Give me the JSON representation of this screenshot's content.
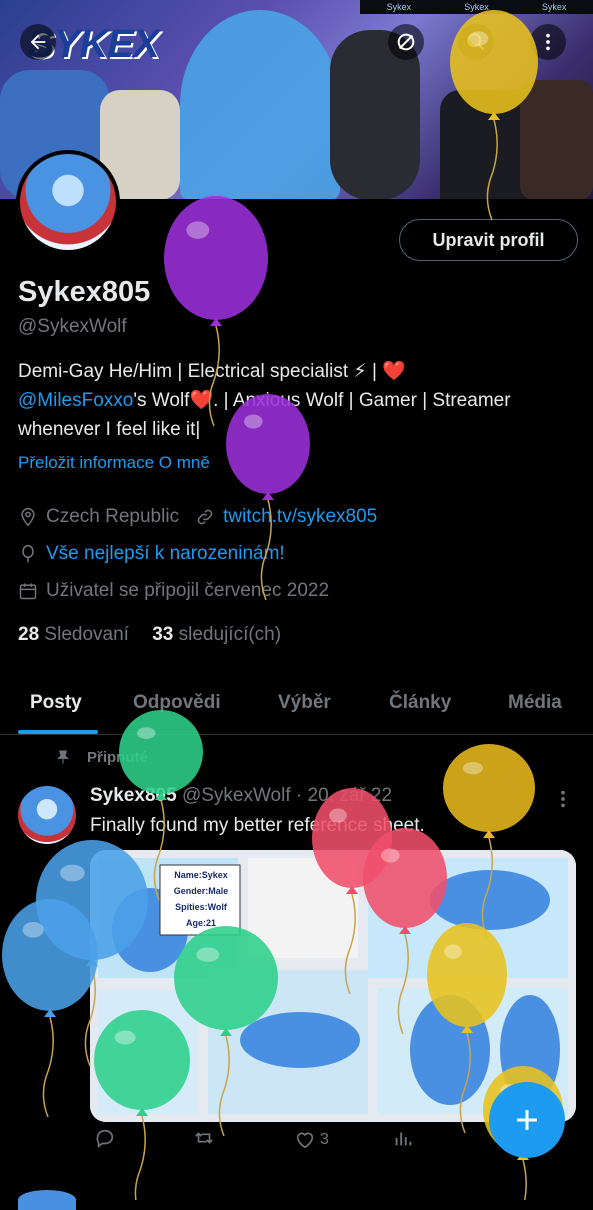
{
  "banner": {
    "logo_text": "SYKEX",
    "links": [
      "Sykex",
      "Sykex",
      "Sykex"
    ]
  },
  "top_bar": {
    "back_icon": "arrow-left-icon",
    "hide_icon": "eye-slash-icon",
    "search_icon": "search-icon",
    "more_icon": "more-vertical-icon"
  },
  "profile": {
    "edit_label": "Upravit profil",
    "name": "Sykex805",
    "handle": "@SykexWolf",
    "bio_line1": "Demi-Gay He/Him | Electrical specialist ⚡ | ❤️",
    "bio_mention": "@MilesFoxxo",
    "bio_line2_rest": "'s Wolf❤️.  | Anxious Wolf | Gamer | Streamer",
    "bio_line3": "whenever I feel like it|",
    "translate": "Přeložit informace O mně",
    "location": "Czech Republic",
    "website": "twitch.tv/sykex805",
    "birthday": "Vše nejlepší k narozeninám!",
    "joined": "Uživatel se připojil červenec 2022",
    "following_count": "28",
    "following_label": "Sledovaní",
    "followers_count": "33",
    "followers_label": "sledující(ch)"
  },
  "tabs": [
    "Posty",
    "Odpovědi",
    "Výběr",
    "Články",
    "Média"
  ],
  "pinned_post": {
    "pinned_label": "Připnuté",
    "author_name": "Sykex805",
    "author_handle": "@SykexWolf",
    "date": "· 20. zář 22",
    "text": "Finally found my better reference sheet.",
    "ref_card": [
      "Name:Sykex",
      "Gender:Male",
      "Spities:Wolf",
      "Age:21"
    ],
    "likes": "3"
  },
  "colors": {
    "accent": "#1d9bf0",
    "background": "#000000",
    "muted": "#71767b",
    "text": "#e7e9ea"
  },
  "balloons": [
    {
      "color": "#9b30d9"
    },
    {
      "color": "#9b30d9"
    },
    {
      "color": "#e8c21c"
    },
    {
      "color": "#2ecf8a"
    },
    {
      "color": "#e8b81c"
    },
    {
      "color": "#f04e6a"
    },
    {
      "color": "#4aa0e8"
    },
    {
      "color": "#4aa0e8"
    },
    {
      "color": "#2ecf8a"
    },
    {
      "color": "#2ecf8a"
    },
    {
      "color": "#f04e6a"
    },
    {
      "color": "#e8c21c"
    },
    {
      "color": "#e8c21c"
    }
  ]
}
